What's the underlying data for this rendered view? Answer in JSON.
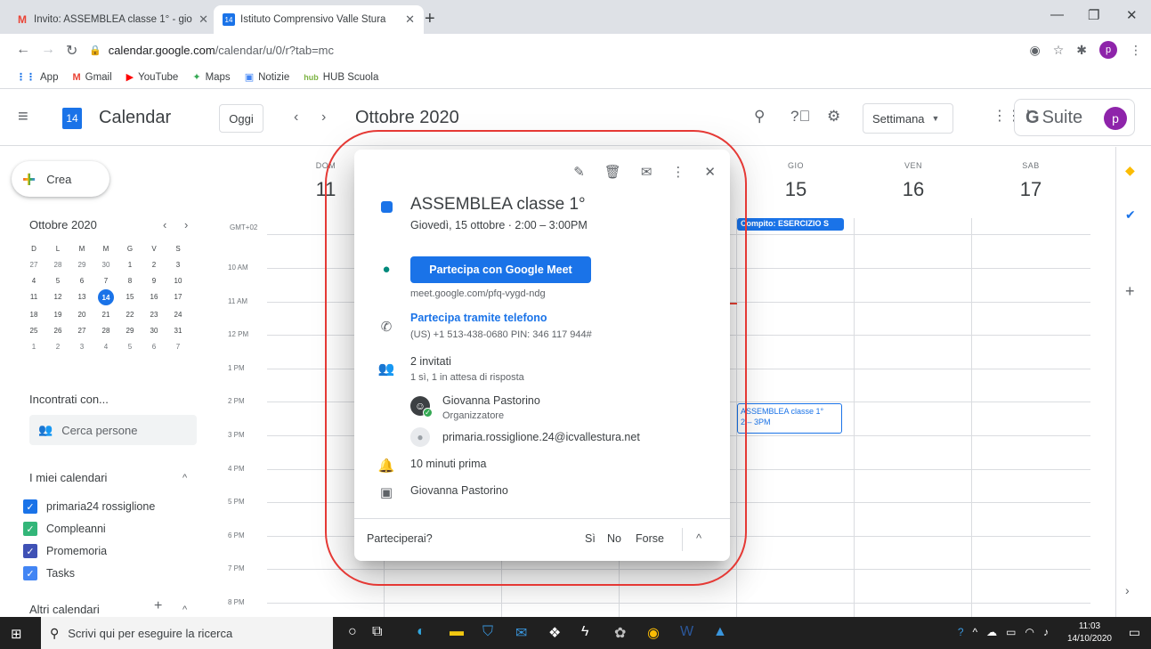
{
  "browser": {
    "tabs": [
      {
        "title": "Invito: ASSEMBLEA classe 1° - gio",
        "favicon": "gmail-icon",
        "active": false
      },
      {
        "title": "Istituto Comprensivo Valle Stura",
        "favicon": "calendar-icon",
        "active": true
      }
    ],
    "url_host": "calendar.google.com",
    "url_path": "/calendar/u/0/r?tab=mc",
    "profile_initial": "p",
    "bookmarks": [
      "App",
      "Gmail",
      "YouTube",
      "Maps",
      "Notizie",
      "HUB Scuola"
    ]
  },
  "header": {
    "logo_day": "14",
    "app_title": "Calendar",
    "today_label": "Oggi",
    "month_title": "Ottobre 2020",
    "view_label": "Settimana",
    "gsuite_label": "Suite",
    "gsuite_g": "G",
    "avatar_initial": "p"
  },
  "sidebar": {
    "create_label": "Crea",
    "mini_month": "Ottobre 2020",
    "weekday_letters": [
      "D",
      "L",
      "M",
      "M",
      "G",
      "V",
      "S"
    ],
    "weeks": [
      [
        "27",
        "28",
        "29",
        "30",
        "1",
        "2",
        "3"
      ],
      [
        "4",
        "5",
        "6",
        "7",
        "8",
        "9",
        "10"
      ],
      [
        "11",
        "12",
        "13",
        "14",
        "15",
        "16",
        "17"
      ],
      [
        "18",
        "19",
        "20",
        "21",
        "22",
        "23",
        "24"
      ],
      [
        "25",
        "26",
        "27",
        "28",
        "29",
        "30",
        "31"
      ],
      [
        "1",
        "2",
        "3",
        "4",
        "5",
        "6",
        "7"
      ]
    ],
    "today": "14",
    "meet_title": "Incontrati con...",
    "search_people": "Cerca persone",
    "my_calendars_title": "I miei calendari",
    "my_calendars": [
      {
        "name": "primaria24 rossiglione",
        "color": "#1a73e8"
      },
      {
        "name": "Compleanni",
        "color": "#33b679"
      },
      {
        "name": "Promemoria",
        "color": "#3f51b5"
      },
      {
        "name": "Tasks",
        "color": "#4285f4"
      }
    ],
    "other_calendars_title": "Altri calendari"
  },
  "week": {
    "timezone": "GMT+02",
    "days": [
      {
        "name": "DOM",
        "date": "11"
      },
      {
        "name": "GIO",
        "date": "15"
      },
      {
        "name": "VEN",
        "date": "16"
      },
      {
        "name": "SAB",
        "date": "17"
      }
    ],
    "hours": [
      "10 AM",
      "11 AM",
      "12 PM",
      "1 PM",
      "2 PM",
      "3 PM",
      "4 PM",
      "5 PM",
      "6 PM",
      "7 PM",
      "8 PM"
    ],
    "task_chip": "Compito: ESERCIZIO S",
    "event_chip_title": "ASSEMBLEA classe 1°",
    "event_chip_time": "2 – 3PM"
  },
  "popup": {
    "title": "ASSEMBLEA classe 1°",
    "date": "Giovedì, 15 ottobre  ·  2:00 – 3:00PM",
    "meet_button": "Partecipa con Google Meet",
    "meet_link": "meet.google.com/pfq-vygd-ndg",
    "phone_label": "Partecipa tramite telefono",
    "phone_details": "(US) +1 513-438-0680 PIN: 346 117 944#",
    "guests_count": "2 invitati",
    "guests_status": "1 sì, 1 in attesa di risposta",
    "organizer_name": "Giovanna Pastorino",
    "organizer_role": "Organizzatore",
    "guest_email": "primaria.rossiglione.24@icvallestura.net",
    "reminder": "10 minuti prima",
    "calendar_owner": "Giovanna Pastorino",
    "rsvp_question": "Parteciperai?",
    "rsvp_yes": "Sì",
    "rsvp_no": "No",
    "rsvp_maybe": "Forse"
  },
  "taskbar": {
    "search_placeholder": "Scrivi qui per eseguire la ricerca",
    "time": "11:03",
    "date": "14/10/2020"
  },
  "colors": {
    "accent": "#1a73e8",
    "annotation": "#e53935"
  }
}
